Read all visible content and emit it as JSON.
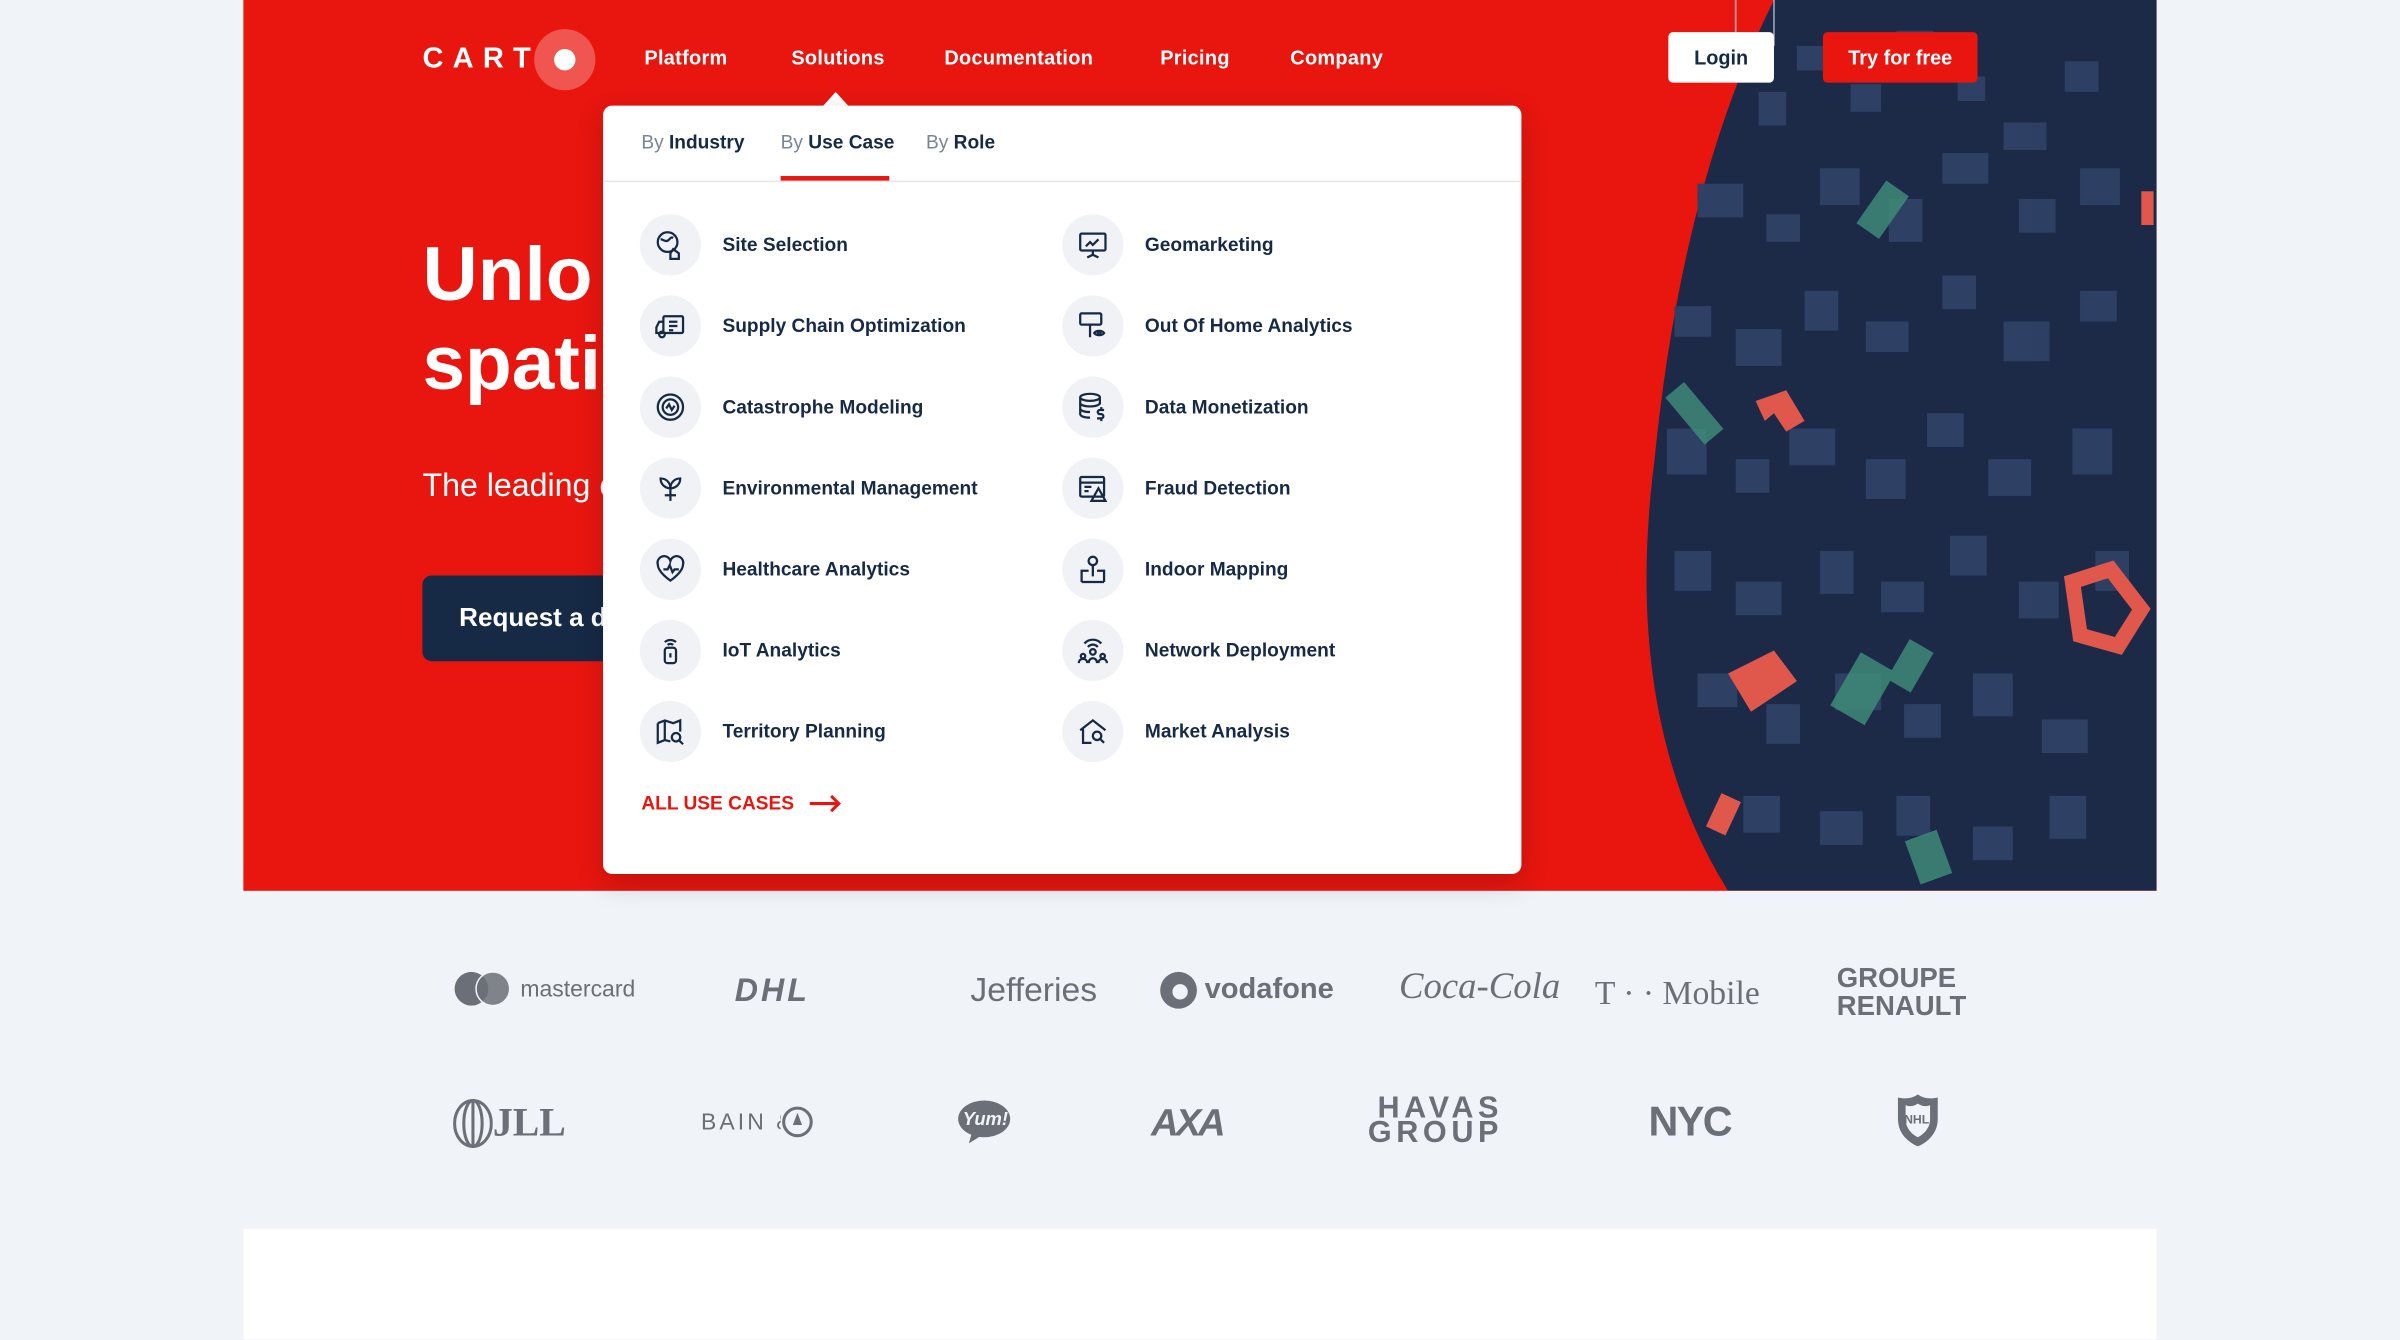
{
  "brand": {
    "name": "CARTO",
    "primary": "#e8160f",
    "navy": "#162945",
    "map_bg": "#1c2a48"
  },
  "nav": {
    "items": [
      "Platform",
      "Solutions",
      "Documentation",
      "Pricing",
      "Company"
    ],
    "login": "Login",
    "try": "Try for free"
  },
  "hero": {
    "title_line1": "Unlo",
    "title_line2": "spati",
    "subtitle": "The leading c",
    "cta": "Request a d"
  },
  "dropdown": {
    "tabs": [
      {
        "prefix": "By",
        "label": "Industry"
      },
      {
        "prefix": "By",
        "label": "Use Case"
      },
      {
        "prefix": "By",
        "label": "Role"
      }
    ],
    "active_tab": "Use Case",
    "left": [
      {
        "label": "Site Selection",
        "icon": "site-selection-icon"
      },
      {
        "label": "Supply Chain Optimization",
        "icon": "truck-icon"
      },
      {
        "label": "Catastrophe Modeling",
        "icon": "target-icon"
      },
      {
        "label": "Environmental Management",
        "icon": "plant-icon"
      },
      {
        "label": "Healthcare Analytics",
        "icon": "heart-pulse-icon"
      },
      {
        "label": "IoT Analytics",
        "icon": "iot-icon"
      },
      {
        "label": "Territory Planning",
        "icon": "map-search-icon"
      }
    ],
    "right": [
      {
        "label": "Geomarketing",
        "icon": "presentation-icon"
      },
      {
        "label": "Out Of Home Analytics",
        "icon": "billboard-eye-icon"
      },
      {
        "label": "Data Monetization",
        "icon": "database-dollar-icon"
      },
      {
        "label": "Fraud Detection",
        "icon": "fraud-alert-icon"
      },
      {
        "label": "Indoor Mapping",
        "icon": "indoor-pin-icon"
      },
      {
        "label": "Network Deployment",
        "icon": "network-people-icon"
      },
      {
        "label": "Market Analysis",
        "icon": "house-search-icon"
      }
    ],
    "all_link": "ALL USE CASES"
  },
  "logos": {
    "row1": [
      "mastercard",
      "DHL",
      "Jefferies",
      "vodafone",
      "Coca-Cola",
      "T · · Mobile",
      "GROUPE RENAULT"
    ],
    "row2": [
      "JLL",
      "BAIN & COMPANY",
      "Yum!",
      "AXA",
      "HAVAS GROUP",
      "NYC",
      "NHL"
    ]
  }
}
